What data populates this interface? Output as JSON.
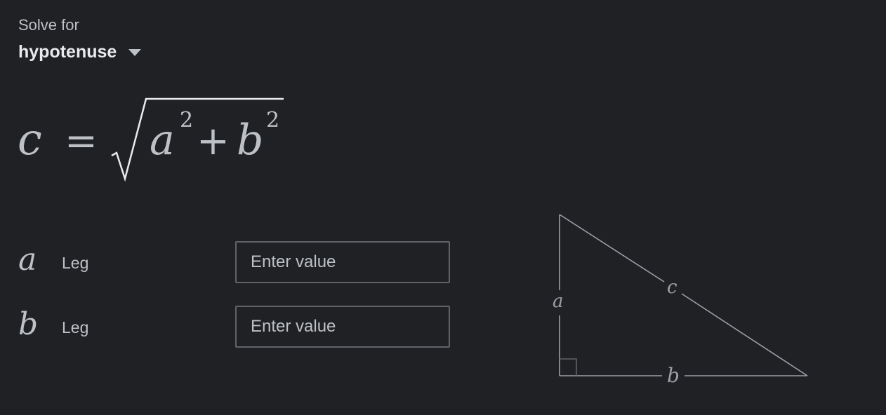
{
  "solve_for": {
    "label": "Solve for",
    "selected": "hypotenuse"
  },
  "formula": {
    "lhs": "c",
    "equals": "=",
    "term1": "a",
    "exp1": "2",
    "plus": "+",
    "term2": "b",
    "exp2": "2"
  },
  "variables": [
    {
      "symbol": "a",
      "description": "Leg",
      "placeholder": "Enter value",
      "value": ""
    },
    {
      "symbol": "b",
      "description": "Leg",
      "placeholder": "Enter value",
      "value": ""
    }
  ],
  "diagram": {
    "label_a": "a",
    "label_b": "b",
    "label_c": "c"
  },
  "icons": {
    "dropdown": "caret-down-icon"
  },
  "colors": {
    "background": "#202124",
    "text": "#bdc1c6",
    "text_strong": "#e8eaed",
    "input_border": "#5f6368"
  }
}
